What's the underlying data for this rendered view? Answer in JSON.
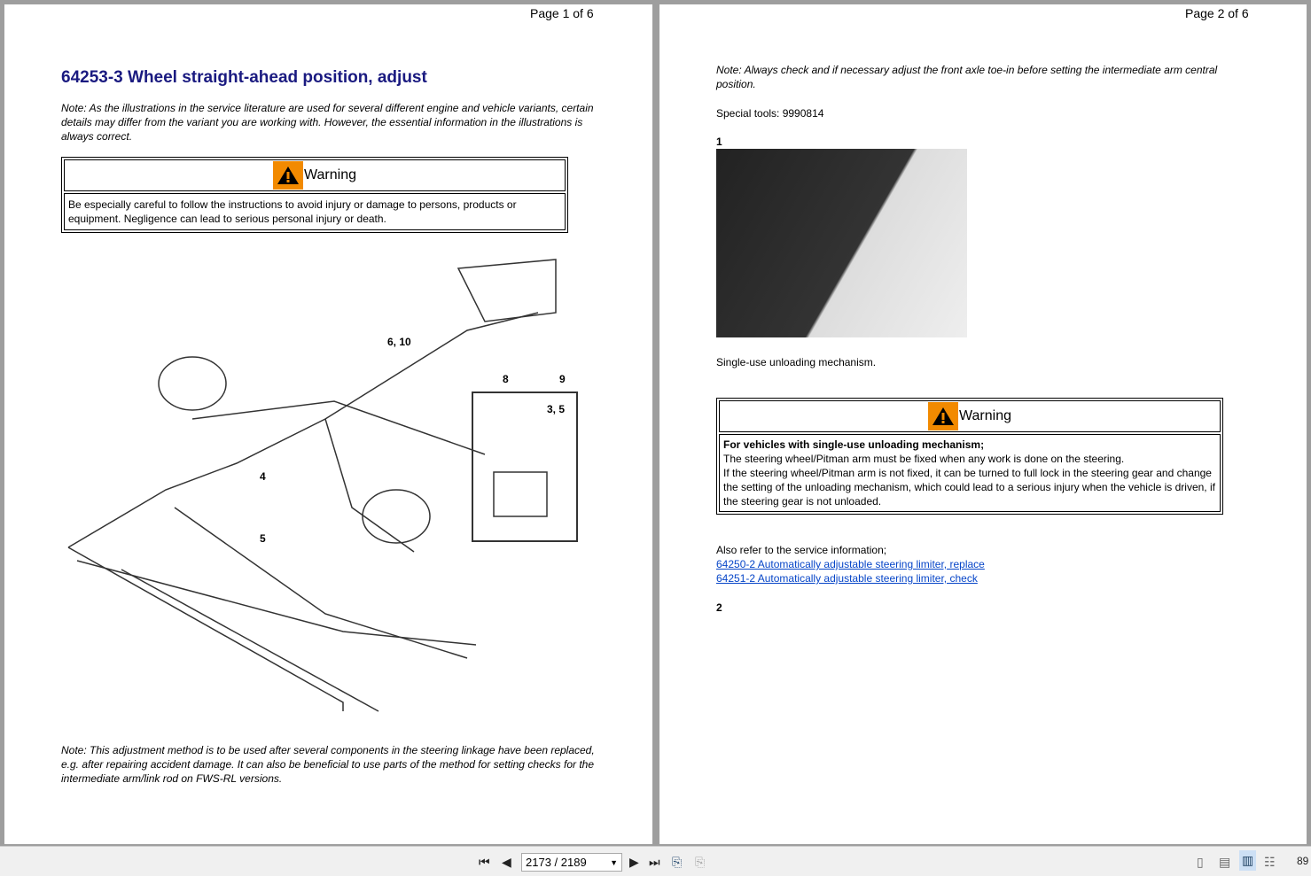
{
  "page1": {
    "page_number": "Page 1 of 6",
    "title": "64253-3 Wheel straight-ahead position, adjust",
    "note1": "Note: As the illustrations in the service literature are used for several different engine and vehicle variants, certain details may differ from the variant you are working with. However, the essential information in the illustrations is always correct.",
    "warning": {
      "heading": "Warning",
      "body": "Be especially careful to follow the instructions to avoid injury or damage to persons, products or equipment. Negligence can lead to serious personal injury or death."
    },
    "diagram_labels": [
      "6, 10",
      "8",
      "9",
      "3, 5",
      "4",
      "5"
    ],
    "note2": "Note: This adjustment method is to be used after several components in the steering linkage have been replaced, e.g. after repairing accident damage. It can also be beneficial to use parts of the method for setting checks for the intermediate arm/link rod on FWS-RL versions."
  },
  "page2": {
    "page_number": "Page 2 of 6",
    "note": "Note: Always check and if necessary adjust the front axle toe-in before setting the intermediate arm central position.",
    "special_tools": "Special tools: 9990814",
    "step1": "1",
    "caption": "Single-use unloading mechanism.",
    "warning": {
      "heading": "Warning",
      "bold": "For vehicles with single-use unloading mechanism;",
      "line1": "The steering wheel/Pitman arm must be fixed when any work is done on the steering.",
      "line2": "If the steering wheel/Pitman arm is not fixed, it can be turned to full lock in the steering gear and change the setting of the unloading mechanism, which could lead to a serious injury when the vehicle is driven, if the steering gear is not unloaded."
    },
    "refer": "Also refer to the service information;",
    "links": [
      "64250-2 Automatically adjustable steering limiter, replace",
      "64251-2 Automatically adjustable steering limiter, check"
    ],
    "step2": "2"
  },
  "toolbar": {
    "page_field": "2173 / 2189",
    "zoom": "89"
  }
}
